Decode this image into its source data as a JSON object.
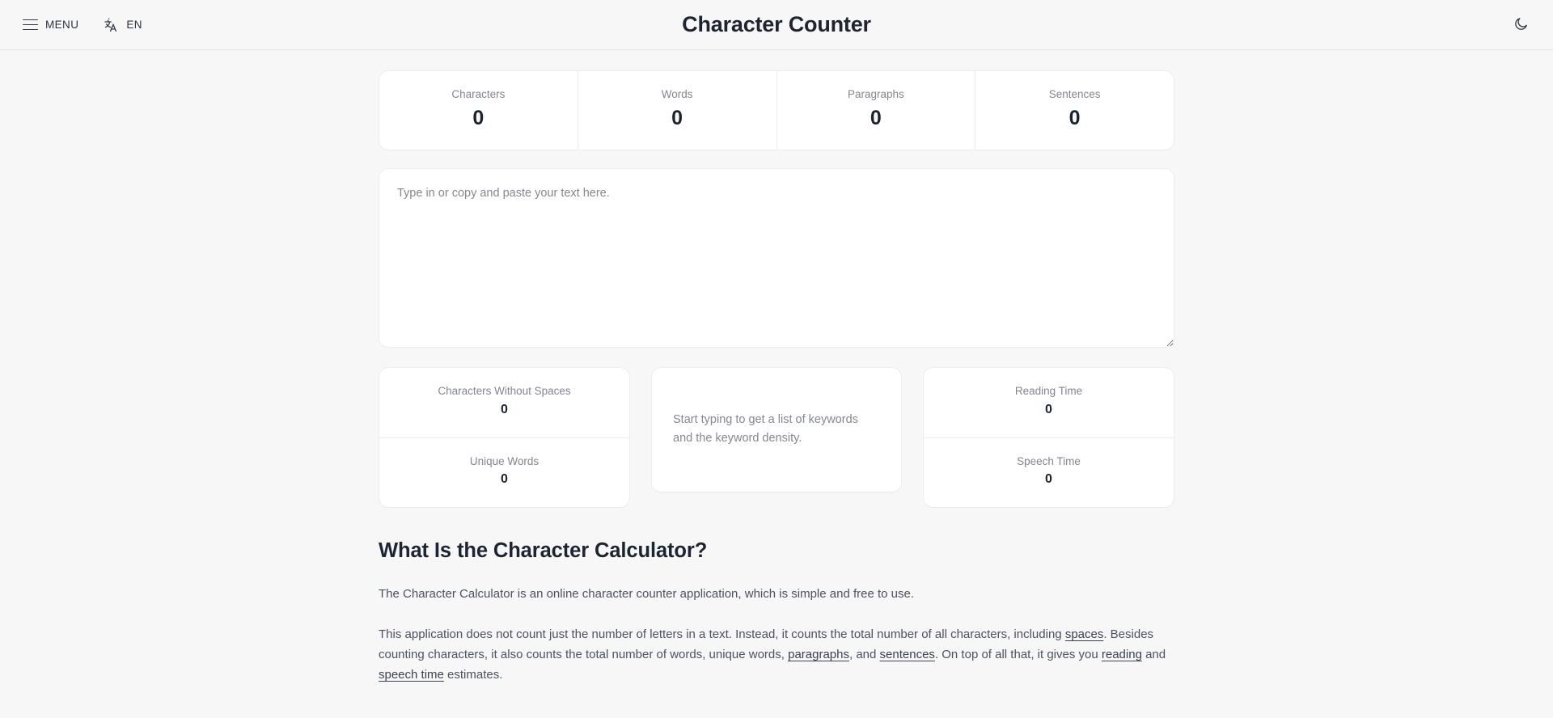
{
  "header": {
    "menu_label": "MENU",
    "lang_label": "EN",
    "title": "Character Counter",
    "menu_icon": "hamburger-icon",
    "lang_icon": "translate-icon",
    "theme_icon": "moon-icon"
  },
  "stats": [
    {
      "label": "Characters",
      "value": "0"
    },
    {
      "label": "Words",
      "value": "0"
    },
    {
      "label": "Paragraphs",
      "value": "0"
    },
    {
      "label": "Sentences",
      "value": "0"
    }
  ],
  "editor": {
    "placeholder": "Type in or copy and paste your text here.",
    "value": ""
  },
  "left_card": [
    {
      "label": "Characters Without Spaces",
      "value": "0"
    },
    {
      "label": "Unique Words",
      "value": "0"
    }
  ],
  "keywords_card": {
    "empty_text": "Start typing to get a list of keywords and the keyword density."
  },
  "right_card": [
    {
      "label": "Reading Time",
      "value": "0"
    },
    {
      "label": "Speech Time",
      "value": "0"
    }
  ],
  "article": {
    "heading": "What Is the Character Calculator?",
    "p1": "The Character Calculator is an online character counter application, which is simple and free to use.",
    "p2_part1": "This application does not count just the number of letters in a text. Instead, it counts the total number of all characters, including ",
    "p2_link1": "spaces",
    "p2_part2": ". Besides counting characters, it also counts the total number of words, unique words, ",
    "p2_link2": "paragraphs",
    "p2_part3": ", and ",
    "p2_link3": "sentences",
    "p2_part4": ". On top of all that, it gives you ",
    "p2_link4": "reading",
    "p2_part5": " and ",
    "p2_link5": "speech time",
    "p2_part6": " estimates."
  },
  "colors": {
    "page_background": "#f7f7f8",
    "card_background": "#ffffff",
    "border": "#ececee",
    "heading_text": "#1e2532",
    "muted_text": "#83868d",
    "body_text": "#4b5260"
  }
}
